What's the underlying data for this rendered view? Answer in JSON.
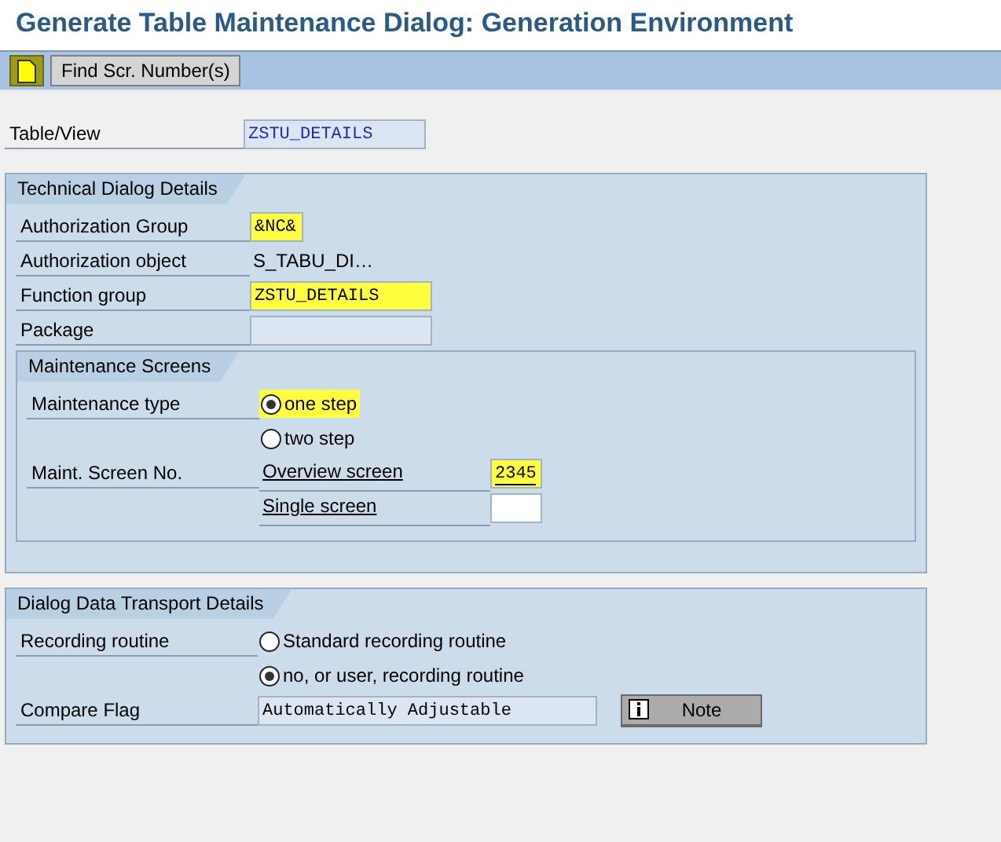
{
  "window": {
    "title": "Generate Table Maintenance Dialog: Generation Environment"
  },
  "toolbar": {
    "buttons": [
      {
        "kind": "icon"
      },
      {
        "kind": "text",
        "label": "Find Scr. Number(s)"
      }
    ]
  },
  "table_view": {
    "label": "Table/View",
    "value": "ZSTU_DETAILS",
    "kind": "field",
    "highlighted": false
  },
  "technical_dialog_details": {
    "title": "Technical Dialog Details",
    "rows": [
      {
        "label": "Authorization Group",
        "kind": "short_input",
        "value": "&NC&",
        "highlighted": true
      },
      {
        "label": "Authorization object",
        "kind": "text",
        "value": "S_TABU_DI…",
        "highlighted": false
      },
      {
        "label": "Function group",
        "kind": "input",
        "value": "ZSTU_DETAILS",
        "highlighted": true
      },
      {
        "label": "Package",
        "kind": "field",
        "value": "",
        "highlighted": false
      }
    ],
    "maintenance_screens": {
      "title": "Maintenance Screens",
      "maintenance_type": {
        "label": "Maintenance type",
        "options": [
          {
            "label": "one step",
            "selected": true,
            "highlighted": true
          },
          {
            "label": "two step",
            "selected": false,
            "highlighted": false
          }
        ]
      },
      "screen_numbers": {
        "label": "Maint. Screen No.",
        "items": [
          {
            "label": "Overview screen",
            "value": "2345",
            "highlighted": true
          },
          {
            "label": "Single screen",
            "value": "",
            "highlighted": false
          }
        ]
      }
    }
  },
  "dialog_data_transport_details": {
    "title": "Dialog Data Transport Details",
    "recording_routine": {
      "label": "Recording routine",
      "options": [
        {
          "label": "Standard recording routine",
          "selected": false,
          "highlighted": false
        },
        {
          "label": "no, or user, recording routine",
          "selected": true,
          "highlighted": false
        }
      ]
    },
    "compare_flag": {
      "label": "Compare Flag",
      "value": "Automatically Adjustable"
    },
    "note_button": {
      "label": "Note"
    }
  }
}
